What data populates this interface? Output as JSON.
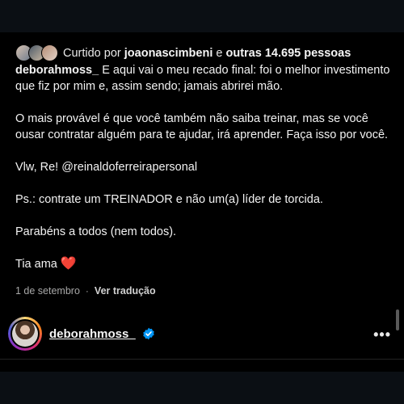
{
  "likes": {
    "prefix": "Curtido por",
    "user": "joaonascimbeni",
    "connector": "e",
    "others": "outras 14.695 pessoas"
  },
  "caption": {
    "username": "deborahmoss_",
    "lines": [
      "E aqui vai o meu recado final: foi o melhor investimento que fiz por mim e, assim sendo; jamais abrirei mão.",
      "O mais provável é que você também não saiba treinar, mas se você ousar contratar alguém para te ajudar, irá aprender. Faça isso por você.",
      "Vlw, Re! @reinaldoferreirapersonal",
      "Ps.: contrate um TREINADOR e não um(a) líder de torcida.",
      "Parabéns a todos (nem todos).",
      "Tia ama"
    ],
    "heart": "❤️"
  },
  "meta": {
    "date": "1 de setembro",
    "separator": "·",
    "translate": "Ver tradução"
  },
  "author": {
    "username": "deborahmoss_",
    "verified_icon": "verified-badge-icon",
    "more_icon": "more-options-icon",
    "more_glyph": "•••"
  },
  "colors": {
    "background": "#000000",
    "frame": "#0b0f14",
    "verified": "#0095f6",
    "heart": "#ff3040"
  }
}
